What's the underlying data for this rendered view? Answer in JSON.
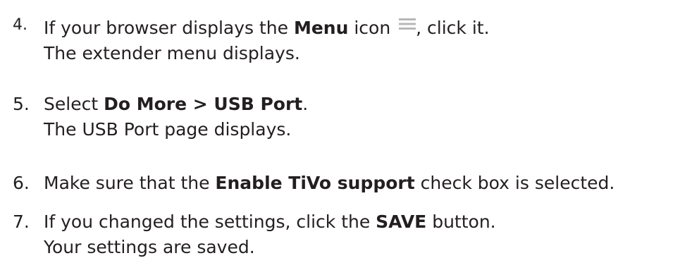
{
  "steps": [
    {
      "number": "4.",
      "line1": {
        "prefix": "If your browser displays the ",
        "bold": "Menu",
        "middle": " icon ",
        "icon": "menu-icon",
        "suffix": ", click it."
      },
      "line2": "The extender menu displays."
    },
    {
      "number": "5.",
      "line1": {
        "prefix": "Select ",
        "bold": "Do More > USB Port",
        "suffix": "."
      },
      "line2": "The USB Port page displays."
    },
    {
      "number": "6.",
      "line1": {
        "prefix": "Make sure that the ",
        "bold": "Enable TiVo support",
        "suffix": " check box is selected."
      }
    },
    {
      "number": "7.",
      "line1": {
        "prefix": "If you changed the settings, click the ",
        "bold": "SAVE",
        "suffix": " button."
      },
      "line2": "Your settings are saved."
    }
  ],
  "colors": {
    "text": "#231f20",
    "icon": "#b7b7b7"
  }
}
